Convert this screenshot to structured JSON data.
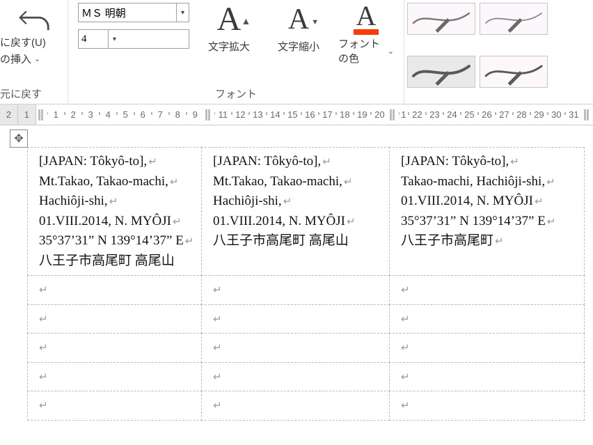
{
  "ribbon": {
    "left": {
      "undo_label": "に戻す(U)",
      "insert_label": "の挿入",
      "group_caption": "元に戻す"
    },
    "font_group": {
      "font_name": "ＭＳ 明朝",
      "font_size": "4",
      "grow_label": "文字拡大",
      "shrink_label": "文字縮小",
      "color_label": "フォントの色",
      "group_caption": "フォント",
      "accent_color": "#ff3c00"
    }
  },
  "ruler": {
    "left_margin": [
      "2",
      "1"
    ],
    "ticks_a": [
      "1",
      "2",
      "3",
      "4",
      "5",
      "6",
      "7",
      "8",
      "9"
    ],
    "ticks_b": [
      "11",
      "12",
      "13",
      "14",
      "15",
      "16",
      "17",
      "18",
      "19",
      "20"
    ],
    "ticks_c": [
      "1",
      "23",
      "24",
      "25",
      "26",
      "27",
      "28",
      "29",
      "30",
      "31"
    ],
    "extra22": "22"
  },
  "labels": {
    "a": {
      "l1": "[JAPAN: Tôkyô-to],",
      "l2": "Mt.Takao, Takao-machi,",
      "l3": "Hachiôji-shi,",
      "l4": "01.VIII.2014, N. MYÔJI",
      "l5": "35°37’31” N 139°14’37” E",
      "l6": "八王子市高尾町  高尾山"
    },
    "b": {
      "l1": "[JAPAN: Tôkyô-to],",
      "l2": "Mt.Takao, Takao-machi,",
      "l3": "Hachiôji-shi,",
      "l4": "01.VIII.2014, N. MYÔJI",
      "l5": "八王子市高尾町  高尾山"
    },
    "c": {
      "l1": "[JAPAN: Tôkyô-to],",
      "l2": "Takao-machi, Hachiôji-shi,",
      "l3": "01.VIII.2014, N. MYÔJI",
      "l4": "35°37’31” N 139°14’37” E",
      "l5": "八王子市高尾町"
    }
  },
  "glyphs": {
    "return": "↵",
    "chevron": "⌄",
    "move": "✥"
  }
}
